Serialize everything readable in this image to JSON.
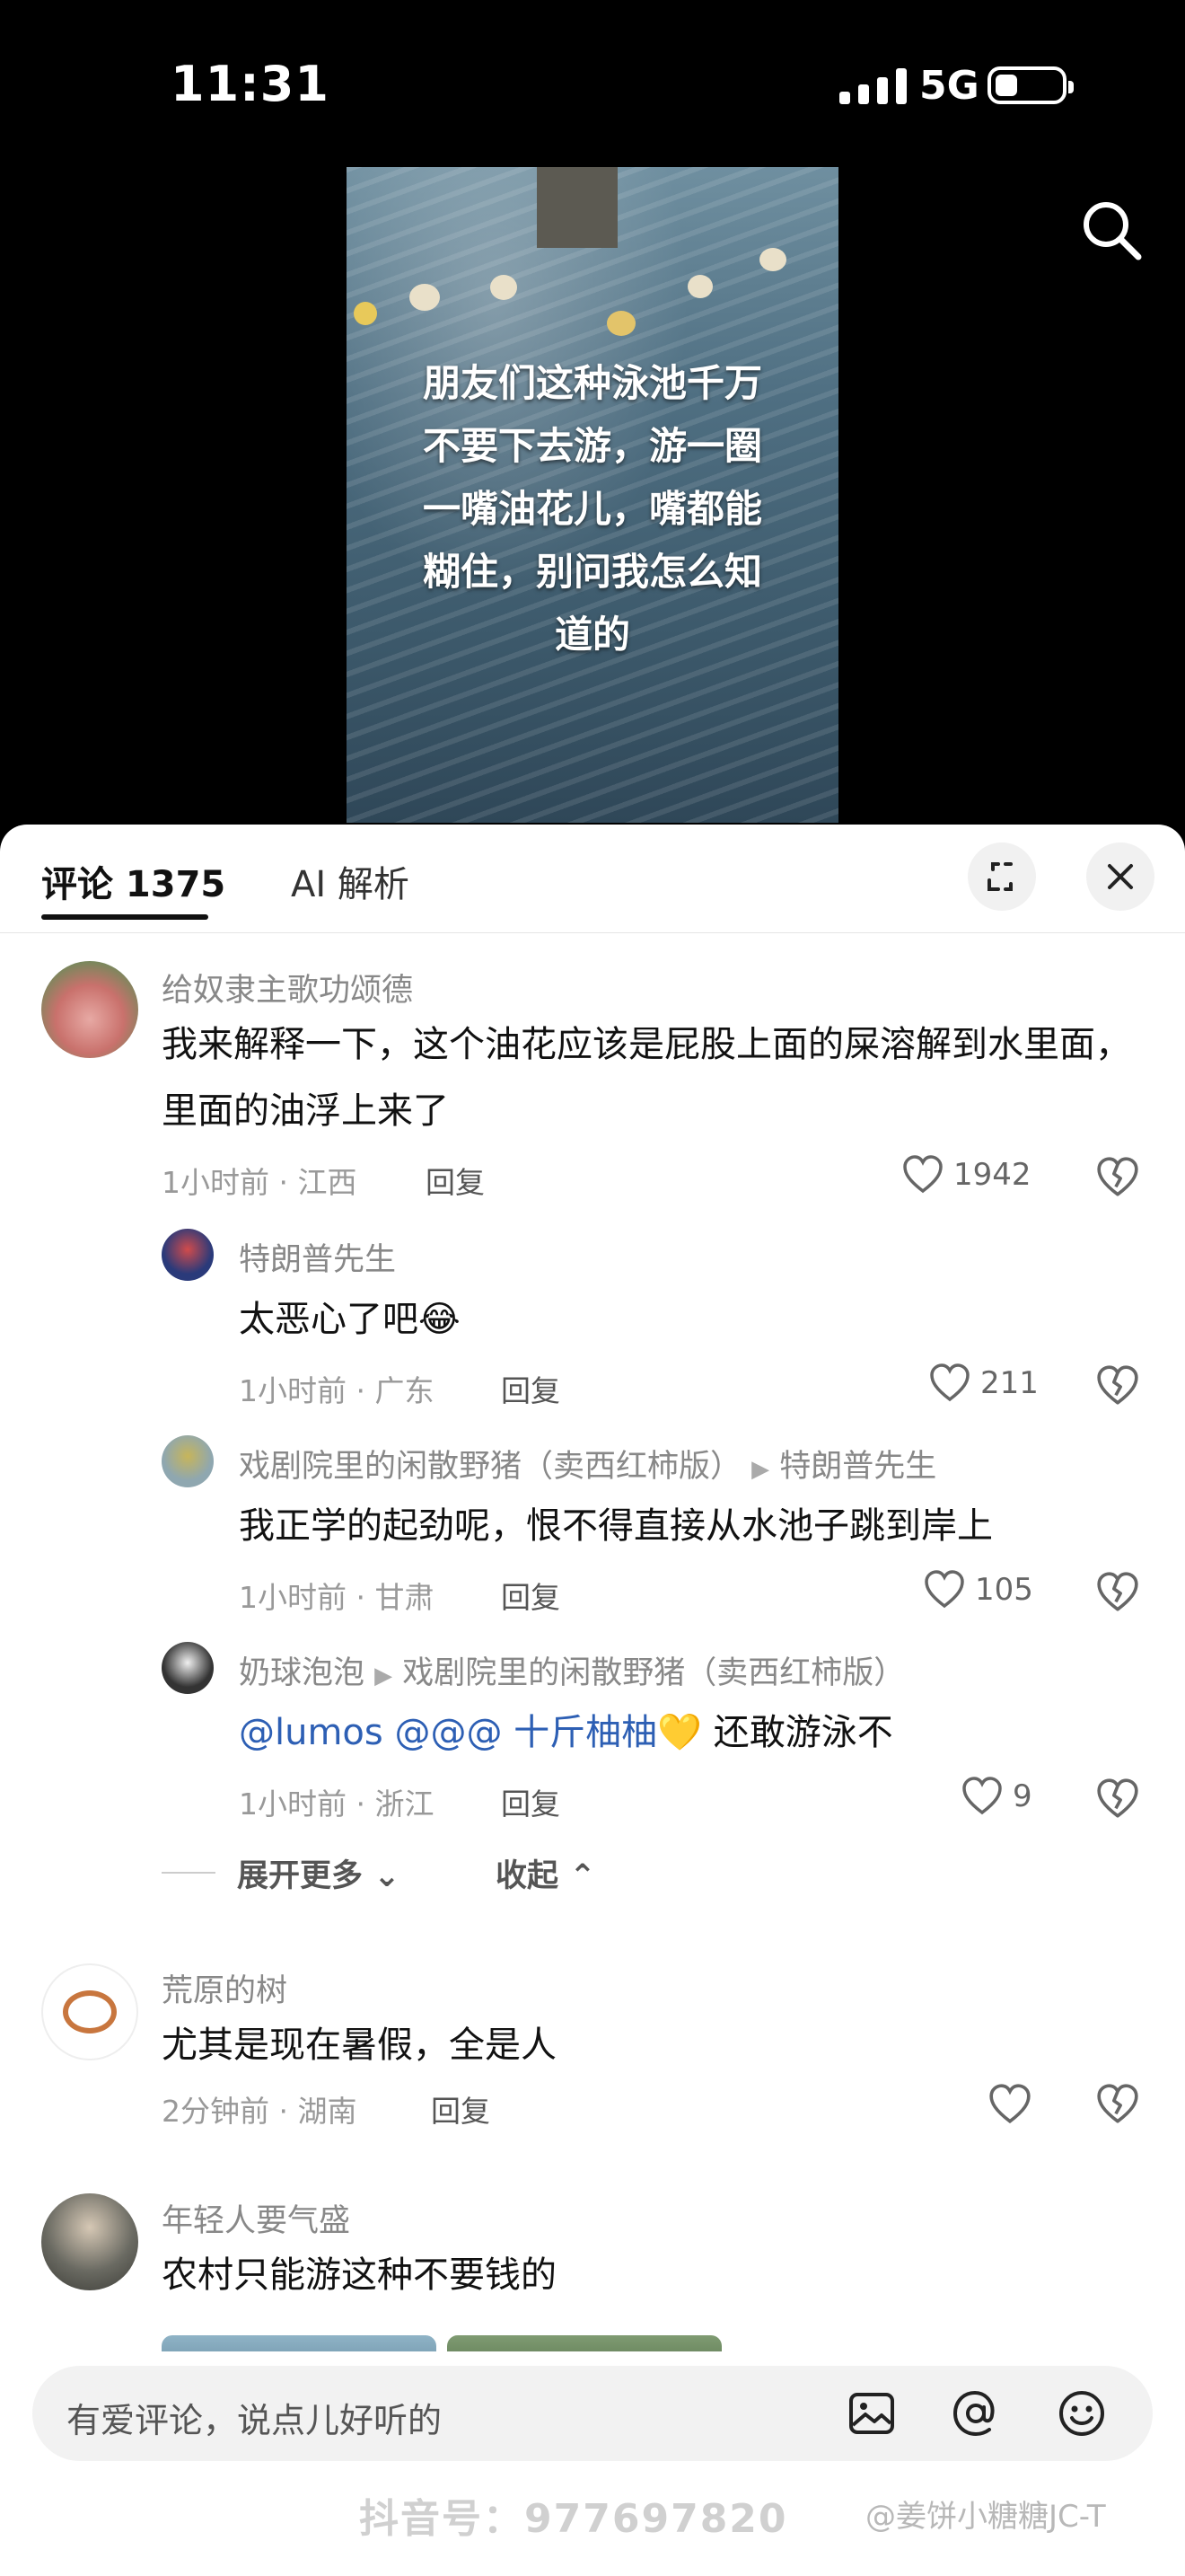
{
  "status_bar": {
    "time": "11:31",
    "network": "5G"
  },
  "video": {
    "caption": "朋友们这种泳池千万\n不要下去游，游一圈\n一嘴油花儿，嘴都能\n糊住，别问我怎么知\n道的"
  },
  "tabs": {
    "comments_label": "评论 1375",
    "ai_label": "AI 解析"
  },
  "comments": [
    {
      "user": "给奴隶主歌功颂德",
      "text": "我来解释一下，这个油花应该是屁股上面的屎溶解到水里面，里面的油浮上来了",
      "meta": "1小时前 · 江西",
      "reply_label": "回复",
      "likes": "1942",
      "replies": [
        {
          "user": "特朗普先生",
          "text": "太恶心了吧😂",
          "meta": "1小时前 · 广东",
          "reply_label": "回复",
          "likes": "211"
        },
        {
          "user": "戏剧院里的闲散野猪（卖西红柿版）",
          "reply_to": "特朗普先生",
          "text": "我正学的起劲呢，恨不得直接从水池子跳到岸上",
          "meta": "1小时前 · 甘肃",
          "reply_label": "回复",
          "likes": "105"
        },
        {
          "user": "奶球泡泡",
          "reply_to": "戏剧院里的闲散野猪（卖西红柿版）",
          "text_mentions": "@lumos @@@ 十斤柚柚💛",
          "text": " 还敢游泳不",
          "meta": "1小时前 · 浙江",
          "reply_label": "回复",
          "likes": "9"
        }
      ],
      "expand_label": "展开更多",
      "collapse_label": "收起"
    },
    {
      "user": "荒原的树",
      "text": "尤其是现在暑假，全是人",
      "meta": "2分钟前 · 湖南",
      "reply_label": "回复"
    },
    {
      "user": "年轻人要气盛",
      "text": "农村只能游这种不要钱的"
    }
  ],
  "input": {
    "placeholder": "有爱评论，说点儿好听的"
  },
  "watermarks": {
    "douyin": "抖音号：977697820",
    "weibo": "@姜饼小糖糖JC-T"
  },
  "colors": {
    "mention": "#2d5fb4",
    "sheet_bg": "#ffffff",
    "page_bg": "#000000"
  }
}
